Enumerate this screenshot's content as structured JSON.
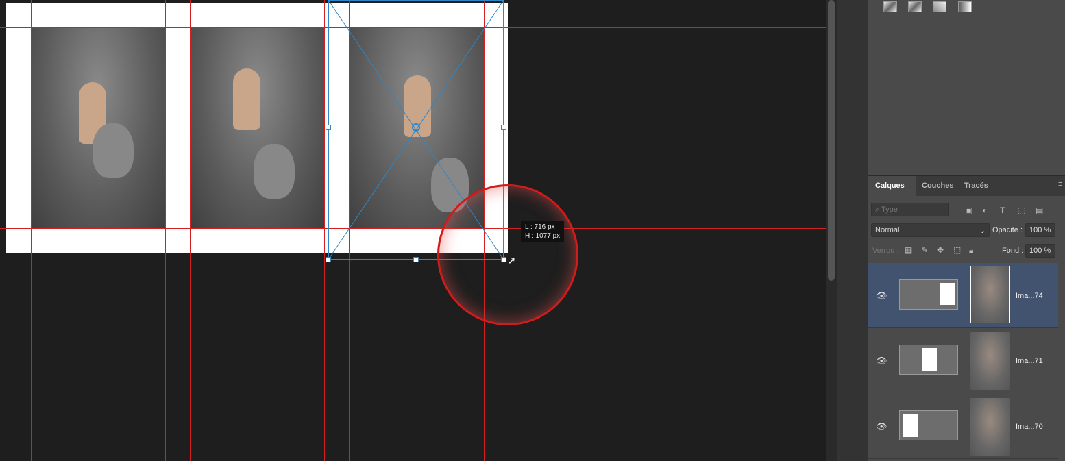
{
  "canvas": {
    "tooltip": {
      "width": "L :  716 px",
      "height": "H : 1077 px"
    }
  },
  "panel": {
    "tabs": [
      "Calques",
      "Couches",
      "Tracés"
    ],
    "search_placeholder": "Type",
    "blend_mode": "Normal",
    "opacity_label": "Opacité :",
    "opacity_value": "100 %",
    "lock_label": "Verrou :",
    "fill_label": "Fond :",
    "fill_value": "100 %",
    "layers": [
      {
        "name": "Ima...74",
        "selected": true
      },
      {
        "name": "Ima...71",
        "selected": false
      },
      {
        "name": "Ima...70",
        "selected": false
      }
    ]
  },
  "colors": {
    "guide": "#d42020",
    "selection": "#2d87c8",
    "selected_layer": "#41536f"
  }
}
